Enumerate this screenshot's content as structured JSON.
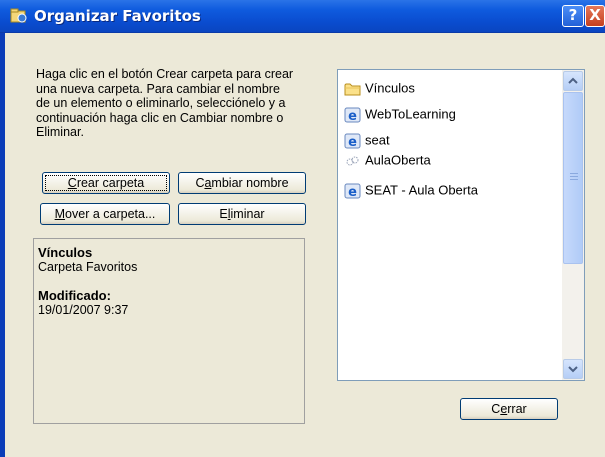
{
  "window": {
    "title": "Organizar Favoritos",
    "help_label": "?",
    "close_label": "X"
  },
  "instructions": "Haga clic en el botón Crear carpeta para crear una nueva carpeta. Para cambiar el nombre de un elemento o eliminarlo, selecciónelo y a continuación haga clic en Cambiar nombre o Eliminar.",
  "buttons": {
    "crear_pre": "",
    "crear_acc": "C",
    "crear_post": "rear carpeta",
    "cambiar_pre": "C",
    "cambiar_acc": "a",
    "cambiar_post": "mbiar nombre",
    "mover_pre": "",
    "mover_acc": "M",
    "mover_post": "over a carpeta...",
    "eliminar_pre": "E",
    "eliminar_acc": "l",
    "eliminar_post": "iminar",
    "cerrar_pre": "C",
    "cerrar_acc": "e",
    "cerrar_post": "rrar"
  },
  "info": {
    "name": "Vínculos",
    "type": "Carpeta Favoritos",
    "modified_label": "Modificado:",
    "modified_value": "19/01/2007 9:37"
  },
  "favorites": [
    {
      "label": "Vínculos",
      "icon": "folder-icon"
    },
    {
      "label": "WebToLearning",
      "icon": "ie-icon"
    },
    {
      "label": "seat",
      "icon": "ie-icon"
    },
    {
      "label": "AulaOberta",
      "icon": "link-icon"
    },
    {
      "label": "SEAT - Aula Oberta",
      "icon": "ie-icon"
    }
  ],
  "colors": {
    "titlebar": "#0a4ccf",
    "dialog_bg": "#ece9d8",
    "button_border": "#003c74"
  }
}
